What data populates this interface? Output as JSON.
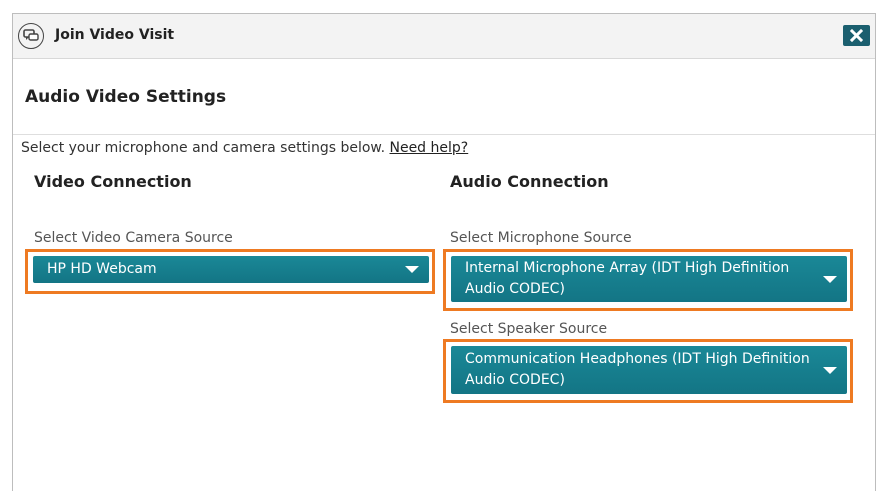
{
  "titlebar": {
    "icon": "chat-bubbles-icon",
    "title": "Join Video Visit",
    "close_icon": "close-icon"
  },
  "header": {
    "title": "Audio Video Settings"
  },
  "intro": {
    "text": "Select your microphone and camera settings below.",
    "help_link": "Need help?"
  },
  "video": {
    "heading": "Video Connection",
    "camera_label": "Select Video Camera Source",
    "camera_value": "HP HD Webcam"
  },
  "audio": {
    "heading": "Audio Connection",
    "mic_label": "Select Microphone Source",
    "mic_value_line1": "Internal Microphone Array (IDT High Definition",
    "mic_value_line2": "Audio CODEC)",
    "speaker_label": "Select Speaker Source",
    "speaker_value_line1": "Communication Headphones (IDT High Definition",
    "speaker_value_line2": "Audio CODEC)"
  },
  "colors": {
    "accent": "#17808f",
    "highlight": "#ee7a22",
    "close_bg": "#1b5f6f"
  }
}
